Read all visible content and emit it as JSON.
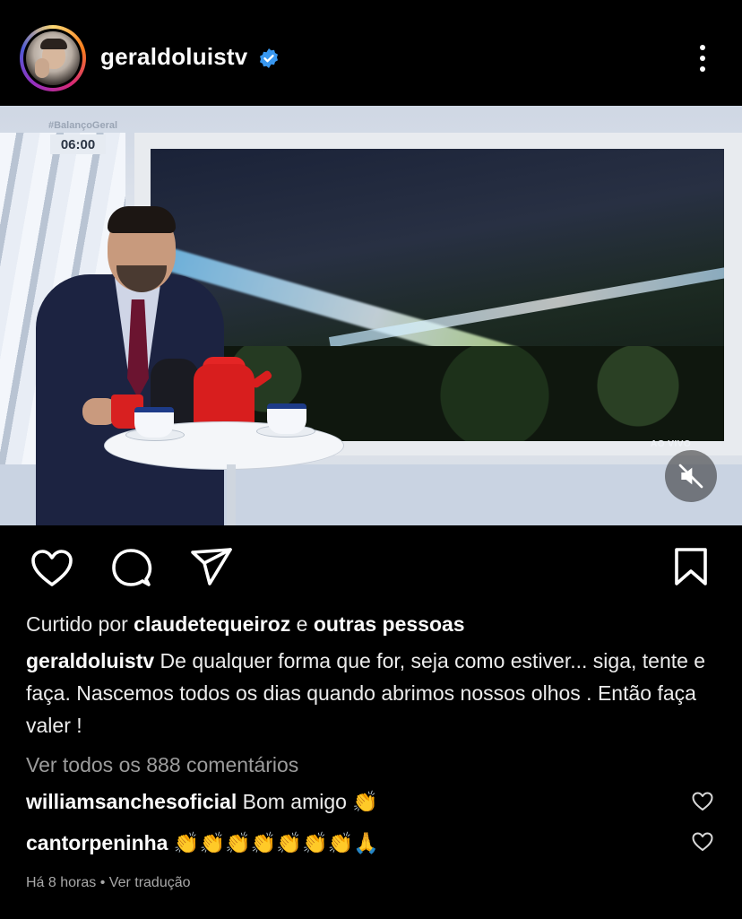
{
  "post": {
    "username": "geraldoluistv",
    "verified": true,
    "more_icon": "more-vertical-icon"
  },
  "media": {
    "tv_logo": "#BalançoGeral",
    "tv_time": "06:00",
    "live_label": "AO VIVO",
    "mute_icon": "volume-muted-icon"
  },
  "actions": {
    "icons": [
      "heart-icon",
      "comment-icon",
      "share-icon",
      "bookmark-icon"
    ]
  },
  "likes": {
    "prefix": "Curtido por",
    "user": "claudetequeiroz",
    "connector": "e",
    "others": "outras pessoas"
  },
  "caption": {
    "username": "geraldoluistv",
    "text": "De qualquer forma que for, seja como estiver... siga, tente e faça. Nascemos todos os dias quando abrimos nossos olhos . Então faça valer !"
  },
  "comments_link": "Ver todos os 888 comentários",
  "comments": [
    {
      "username": "williamsanchesoficial",
      "text": "Bom amigo",
      "emoji": "👏"
    },
    {
      "username": "cantorpeninha",
      "text": "",
      "emoji": "👏👏👏👏👏👏👏🙏"
    }
  ],
  "meta": {
    "time": "Há 8 horas",
    "separator": "•",
    "translate": "Ver tradução"
  },
  "colors": {
    "background": "#000000",
    "verified_blue": "#3897f0",
    "muted_text": "#9c9c9c"
  }
}
